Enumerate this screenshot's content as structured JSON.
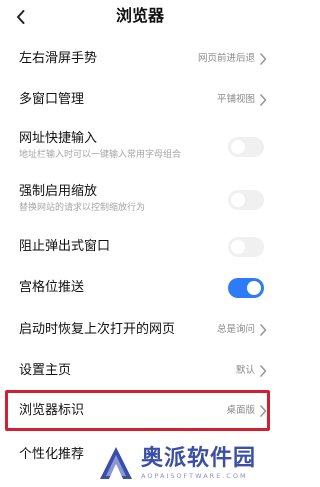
{
  "header": {
    "title": "浏览器",
    "back_icon": "back-arrow-icon"
  },
  "settings": {
    "swipe_gesture": {
      "label": "左右滑屏手势",
      "value": "网页前进后退"
    },
    "multi_window": {
      "label": "多窗口管理",
      "value": "平铺视图"
    },
    "url_shortcut": {
      "label": "网址快捷输入",
      "desc": "地址栏输入时可以一键输入常用字母组合",
      "enabled": false
    },
    "force_zoom": {
      "label": "强制启用缩放",
      "desc": "替换网站的请求以控制缩放行为",
      "enabled": false
    },
    "block_popups": {
      "label": "阻止弹出式窗口",
      "enabled": false
    },
    "grid_push": {
      "label": "宫格位推送",
      "enabled": true
    },
    "restore_pages": {
      "label": "启动时恢复上次打开的网页",
      "value": "总是询问"
    },
    "homepage": {
      "label": "设置主页",
      "value": "默认"
    },
    "user_agent": {
      "label": "浏览器标识",
      "value": "桌面版"
    },
    "personalized": {
      "label": "个性化推荐"
    }
  },
  "colors": {
    "toggle_on": "#2d7cf6",
    "toggle_off": "#f0f0f0",
    "highlight_border": "#d32030",
    "watermark": "#3c4fa7"
  },
  "watermark": {
    "main": "奥派软件园",
    "sub": "AOPAISOFTWARE.COM"
  }
}
